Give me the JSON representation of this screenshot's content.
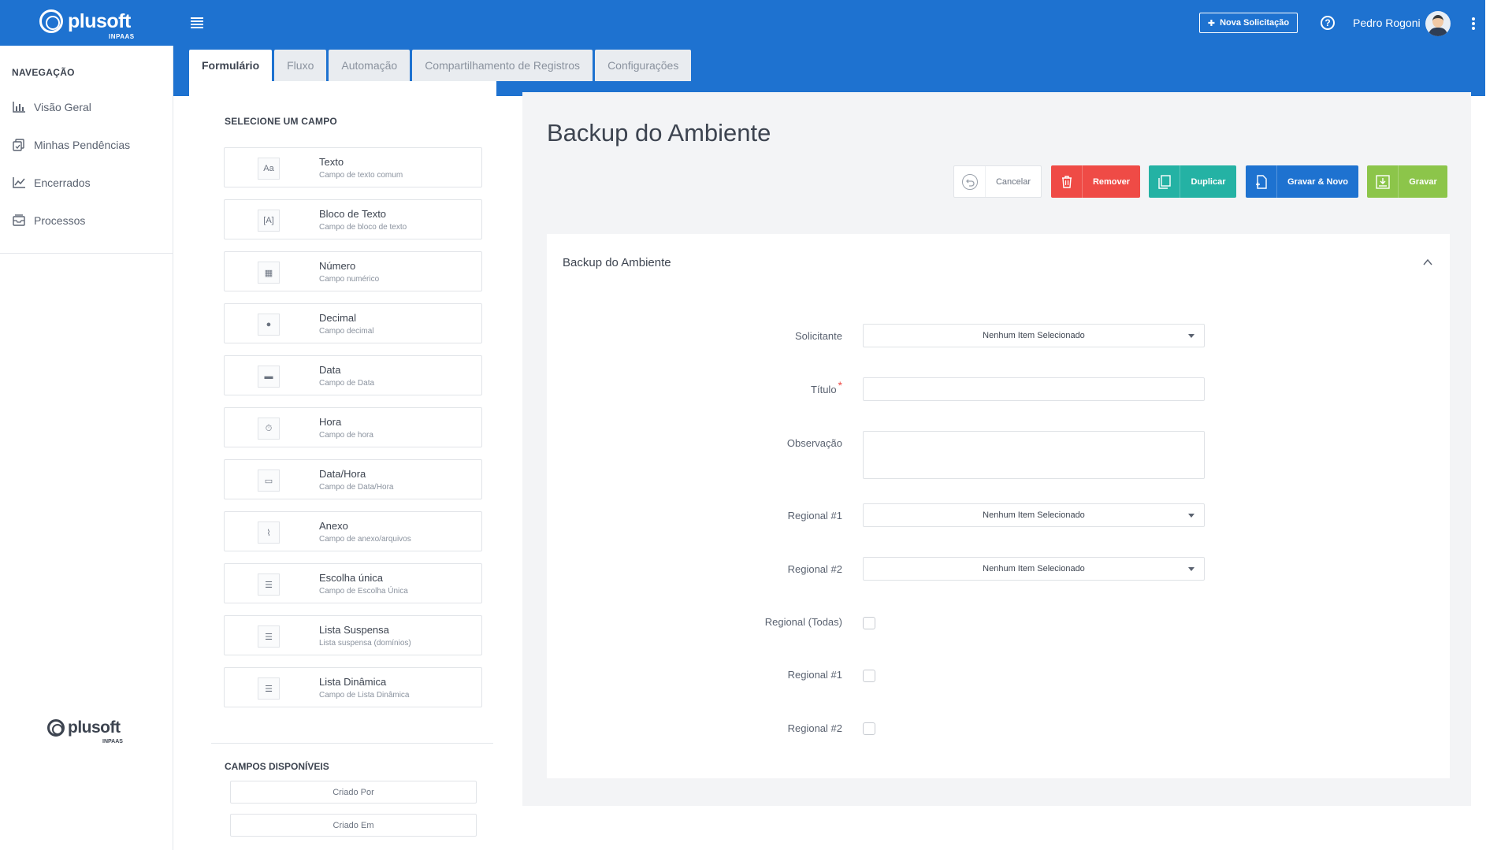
{
  "app": {
    "brand": "plusoft",
    "brand_sub": "INPAAS",
    "new_request_label": "Nova Solicitação",
    "help_label": "?",
    "user_name": "Pedro Rogoni"
  },
  "sidebar": {
    "title": "NAVEGAÇÃO",
    "items": [
      {
        "label": "Visão Geral",
        "icon": "bar-chart-icon"
      },
      {
        "label": "Minhas Pendências",
        "icon": "pending-icon"
      },
      {
        "label": "Encerrados",
        "icon": "line-chart-icon"
      },
      {
        "label": "Processos",
        "icon": "inbox-icon"
      }
    ]
  },
  "tabs": [
    {
      "label": "Formulário",
      "active": true
    },
    {
      "label": "Fluxo",
      "active": false
    },
    {
      "label": "Automação",
      "active": false
    },
    {
      "label": "Compartilhamento de Registros",
      "active": false
    },
    {
      "label": "Configurações",
      "active": false
    }
  ],
  "field_panel": {
    "title": "SELECIONE UM CAMPO",
    "fields": [
      {
        "name": "Texto",
        "desc": "Campo de texto comum",
        "icon": "text-icon"
      },
      {
        "name": "Bloco de Texto",
        "desc": "Campo de bloco de texto",
        "icon": "text-block-icon"
      },
      {
        "name": "Número",
        "desc": "Campo numérico",
        "icon": "number-icon"
      },
      {
        "name": "Decimal",
        "desc": "Campo decimal",
        "icon": "decimal-icon"
      },
      {
        "name": "Data",
        "desc": "Campo de Data",
        "icon": "calendar-icon"
      },
      {
        "name": "Hora",
        "desc": "Campo de hora",
        "icon": "clock-icon"
      },
      {
        "name": "Data/Hora",
        "desc": "Campo de Data/Hora",
        "icon": "datetime-icon"
      },
      {
        "name": "Anexo",
        "desc": "Campo de anexo/arquivos",
        "icon": "paperclip-icon"
      },
      {
        "name": "Escolha única",
        "desc": "Campo de Escolha Única",
        "icon": "list-icon"
      },
      {
        "name": "Lista Suspensa",
        "desc": "Lista suspensa (domínios)",
        "icon": "list-icon"
      },
      {
        "name": "Lista Dinâmica",
        "desc": "Campo de Lista Dinâmica",
        "icon": "list-icon"
      }
    ],
    "available_title": "CAMPOS DISPONÍVEIS",
    "available": [
      "Criado Por",
      "Criado Em"
    ]
  },
  "preview": {
    "title": "Backup do Ambiente",
    "actions": {
      "cancel": "Cancelar",
      "remove": "Remover",
      "duplicate": "Duplicar",
      "save_new": "Gravar & Novo",
      "save": "Gravar"
    },
    "card_title": "Backup do Ambiente",
    "rows": [
      {
        "label": "Solicitante",
        "type": "select",
        "value": "Nenhum Item Selecionado"
      },
      {
        "label": "Título",
        "type": "text",
        "required": true,
        "value": ""
      },
      {
        "label": "Observação",
        "type": "textarea",
        "value": ""
      },
      {
        "label": "Regional #1",
        "type": "select",
        "value": "Nenhum Item Selecionado"
      },
      {
        "label": "Regional #2",
        "type": "select",
        "value": "Nenhum Item Selecionado"
      },
      {
        "label": "Regional (Todas)",
        "type": "checkbox",
        "checked": false
      },
      {
        "label": "Regional #1",
        "type": "checkbox",
        "checked": false
      },
      {
        "label": "Regional #2",
        "type": "checkbox",
        "checked": false
      }
    ]
  },
  "colors": {
    "primary": "#1e72d0",
    "danger": "#ef4b46",
    "teal": "#24b2a4",
    "success": "#8cc54a"
  }
}
